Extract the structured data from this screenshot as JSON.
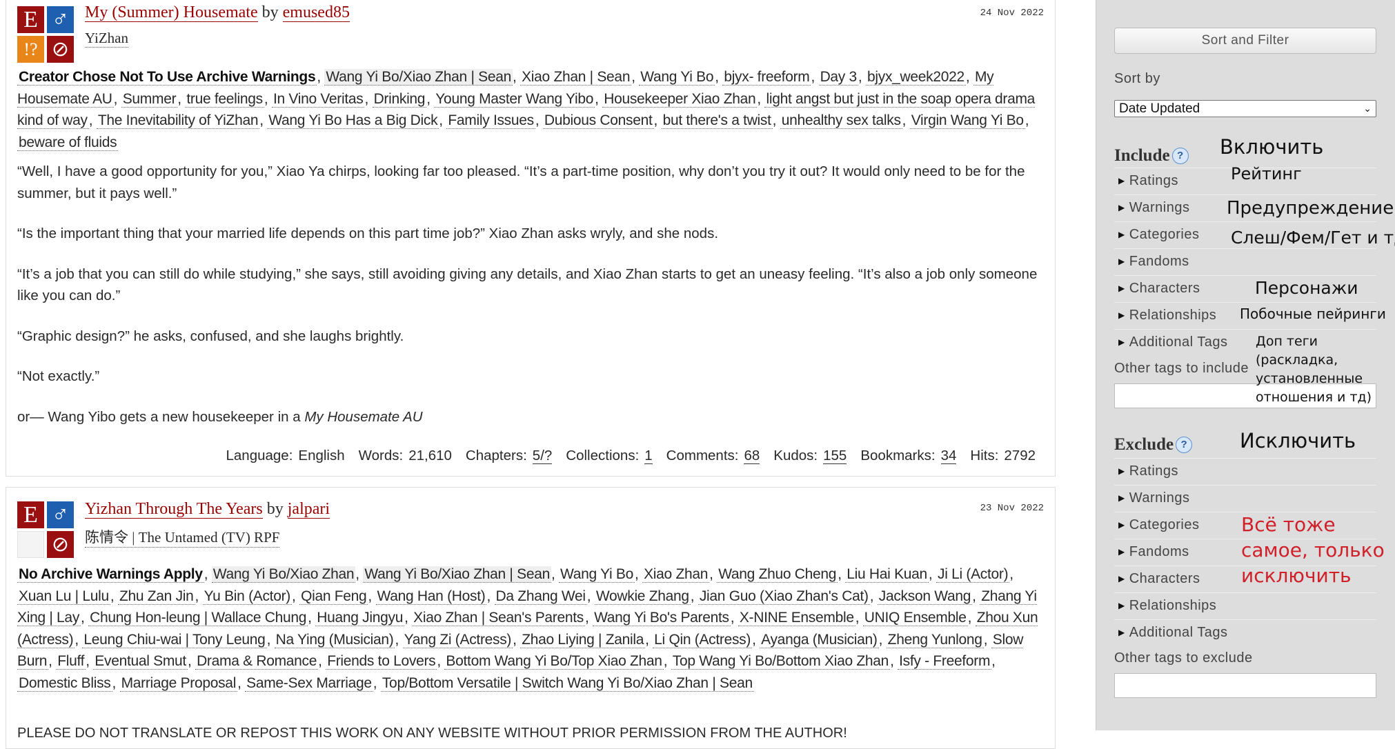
{
  "works": [
    {
      "title": "My (Summer) Housemate",
      "by": "by",
      "author": "emused85",
      "fandom": "YiZhan",
      "date": "24 Nov 2022",
      "icons": [
        "rating-explicit-icon",
        "category-mm-icon",
        "warning-choose-not-icon",
        "work-in-progress-icon"
      ],
      "tags": [
        {
          "t": "Creator Chose Not To Use Archive Warnings",
          "k": "w"
        },
        {
          "t": "Wang Yi Bo/Xiao Zhan | Sean",
          "k": "rel"
        },
        {
          "t": "Xiao Zhan | Sean"
        },
        {
          "t": "Wang Yi Bo"
        },
        {
          "t": "bjyx- freeform"
        },
        {
          "t": "Day 3"
        },
        {
          "t": "bjyx_week2022"
        },
        {
          "t": "My Housemate AU"
        },
        {
          "t": "Summer"
        },
        {
          "t": "true feelings"
        },
        {
          "t": "In Vino Veritas"
        },
        {
          "t": "Drinking"
        },
        {
          "t": "Young Master Wang Yibo"
        },
        {
          "t": "Housekeeper Xiao Zhan"
        },
        {
          "t": "light angst but just in the soap opera drama kind of way"
        },
        {
          "t": "The Inevitability of YiZhan"
        },
        {
          "t": "Wang Yi Bo Has a Big Dick"
        },
        {
          "t": "Family Issues"
        },
        {
          "t": "Dubious Consent"
        },
        {
          "t": "but there's a twist"
        },
        {
          "t": "unhealthy sex talks"
        },
        {
          "t": "Virgin Wang Yi Bo"
        },
        {
          "t": "beware of fluids"
        }
      ],
      "summary": [
        "“Well, I have a good opportunity for you,” Xiao Ya chirps, looking far too pleased. “It’s a part-time position, why don’t you try it out? It would only need to be for the summer, but it pays well.”",
        "“Is the important thing that your married life depends on this part time job?” Xiao Zhan asks wryly, and she nods.",
        "“It’s a job that you can still do while studying,” she says, still avoiding giving any details, and Xiao Zhan starts to get an uneasy feeling. “It’s also a job only someone like you can do.”",
        "“Graphic design?” he asks, confused, and she laughs brightly.",
        "“Not exactly.”"
      ],
      "summary_last_prefix": "or— Wang Yibo gets a new housekeeper in a ",
      "summary_last_em": "My Housemate AU",
      "stats": [
        {
          "l": "Language:",
          "v": "English"
        },
        {
          "l": "Words:",
          "v": "21,610"
        },
        {
          "l": "Chapters:",
          "v": "5/?",
          "u": true
        },
        {
          "l": "Collections:",
          "v": "1",
          "u": true
        },
        {
          "l": "Comments:",
          "v": "68",
          "u": true
        },
        {
          "l": "Kudos:",
          "v": "155",
          "u": true
        },
        {
          "l": "Bookmarks:",
          "v": "34",
          "u": true
        },
        {
          "l": "Hits:",
          "v": "2792"
        }
      ]
    },
    {
      "title": "Yizhan Through The Years",
      "by": "by",
      "author": "jalpari",
      "fandom": "陈情令 | The Untamed (TV) RPF",
      "date": "23 Nov 2022",
      "icons": [
        "rating-explicit-icon",
        "category-mm-icon",
        "no-warnings-icon",
        "work-complete-icon"
      ],
      "tags": [
        {
          "t": "No Archive Warnings Apply",
          "k": "w"
        },
        {
          "t": "Wang Yi Bo/Xiao Zhan",
          "k": "rel"
        },
        {
          "t": "Wang Yi Bo/Xiao Zhan | Sean",
          "k": "rel"
        },
        {
          "t": "Wang Yi Bo"
        },
        {
          "t": "Xiao Zhan"
        },
        {
          "t": "Wang Zhuo Cheng"
        },
        {
          "t": "Liu Hai Kuan"
        },
        {
          "t": "Ji Li (Actor)"
        },
        {
          "t": "Xuan Lu | Lulu"
        },
        {
          "t": "Zhu Zan Jin"
        },
        {
          "t": "Yu Bin (Actor)"
        },
        {
          "t": "Qian Feng"
        },
        {
          "t": "Wang Han (Host)"
        },
        {
          "t": "Da Zhang Wei"
        },
        {
          "t": "Wowkie Zhang"
        },
        {
          "t": "Jian Guo (Xiao Zhan's Cat)"
        },
        {
          "t": "Jackson Wang"
        },
        {
          "t": "Zhang Yi Xing | Lay"
        },
        {
          "t": "Chung Hon-leung | Wallace Chung"
        },
        {
          "t": "Huang Jingyu"
        },
        {
          "t": "Xiao Zhan | Sean's Parents"
        },
        {
          "t": "Wang Yi Bo's Parents"
        },
        {
          "t": "X-NINE Ensemble"
        },
        {
          "t": "UNIQ Ensemble"
        },
        {
          "t": "Zhou Xun (Actress)"
        },
        {
          "t": "Leung Chiu-wai | Tony Leung"
        },
        {
          "t": "Na Ying (Musician)"
        },
        {
          "t": "Yang Zi (Actress)"
        },
        {
          "t": "Zhao Liying | Zanila"
        },
        {
          "t": "Li Qin (Actress)"
        },
        {
          "t": "Ayanga (Musician)"
        },
        {
          "t": "Zheng Yunlong"
        },
        {
          "t": "Slow Burn"
        },
        {
          "t": "Fluff"
        },
        {
          "t": "Eventual Smut"
        },
        {
          "t": "Drama & Romance"
        },
        {
          "t": "Friends to Lovers"
        },
        {
          "t": "Bottom Wang Yi Bo/Top Xiao Zhan"
        },
        {
          "t": "Top Wang Yi Bo/Bottom Xiao Zhan"
        },
        {
          "t": "Isfy - Freeform"
        },
        {
          "t": "Domestic Bliss"
        },
        {
          "t": "Marriage Proposal"
        },
        {
          "t": "Same-Sex Marriage"
        },
        {
          "t": "Top/Bottom Versatile | Switch Wang Yi Bo/Xiao Zhan | Sean"
        }
      ],
      "cut_text": "PLEASE DO NOT TRANSLATE OR REPOST THIS WORK ON ANY WEBSITE WITHOUT PRIOR PERMISSION FROM THE AUTHOR!"
    }
  ],
  "sidebar": {
    "button": "Sort and Filter",
    "sort_label": "Sort by",
    "sort_value": "Date Updated",
    "include": {
      "heading": "Include",
      "help": "?",
      "items": [
        "Ratings",
        "Warnings",
        "Categories",
        "Fandoms",
        "Characters",
        "Relationships",
        "Additional Tags"
      ],
      "other_label": "Other tags to include",
      "other_value": ""
    },
    "exclude": {
      "heading": "Exclude",
      "help": "?",
      "items": [
        "Ratings",
        "Warnings",
        "Categories",
        "Fandoms",
        "Characters",
        "Relationships",
        "Additional Tags"
      ],
      "other_label": "Other tags to exclude",
      "other_value": ""
    }
  },
  "annotations": {
    "include": "Включить",
    "ratings": "Рейтинг",
    "warnings": "Предупреждение",
    "categories": "Слеш/Фем/Гет и тд",
    "characters": "Персонажи",
    "relationships": "Побочные пейринги",
    "additional": [
      "Доп теги",
      "(раскладка,",
      "установленные",
      "отношения и тд)"
    ],
    "exclude": "Исключить",
    "exclude_note": [
      "Всё тоже",
      "самое, только",
      "исключить"
    ]
  },
  "colors": {
    "link": "#990000",
    "sidebar_bg": "#dddddd",
    "annotation_red": "#d0202a"
  }
}
